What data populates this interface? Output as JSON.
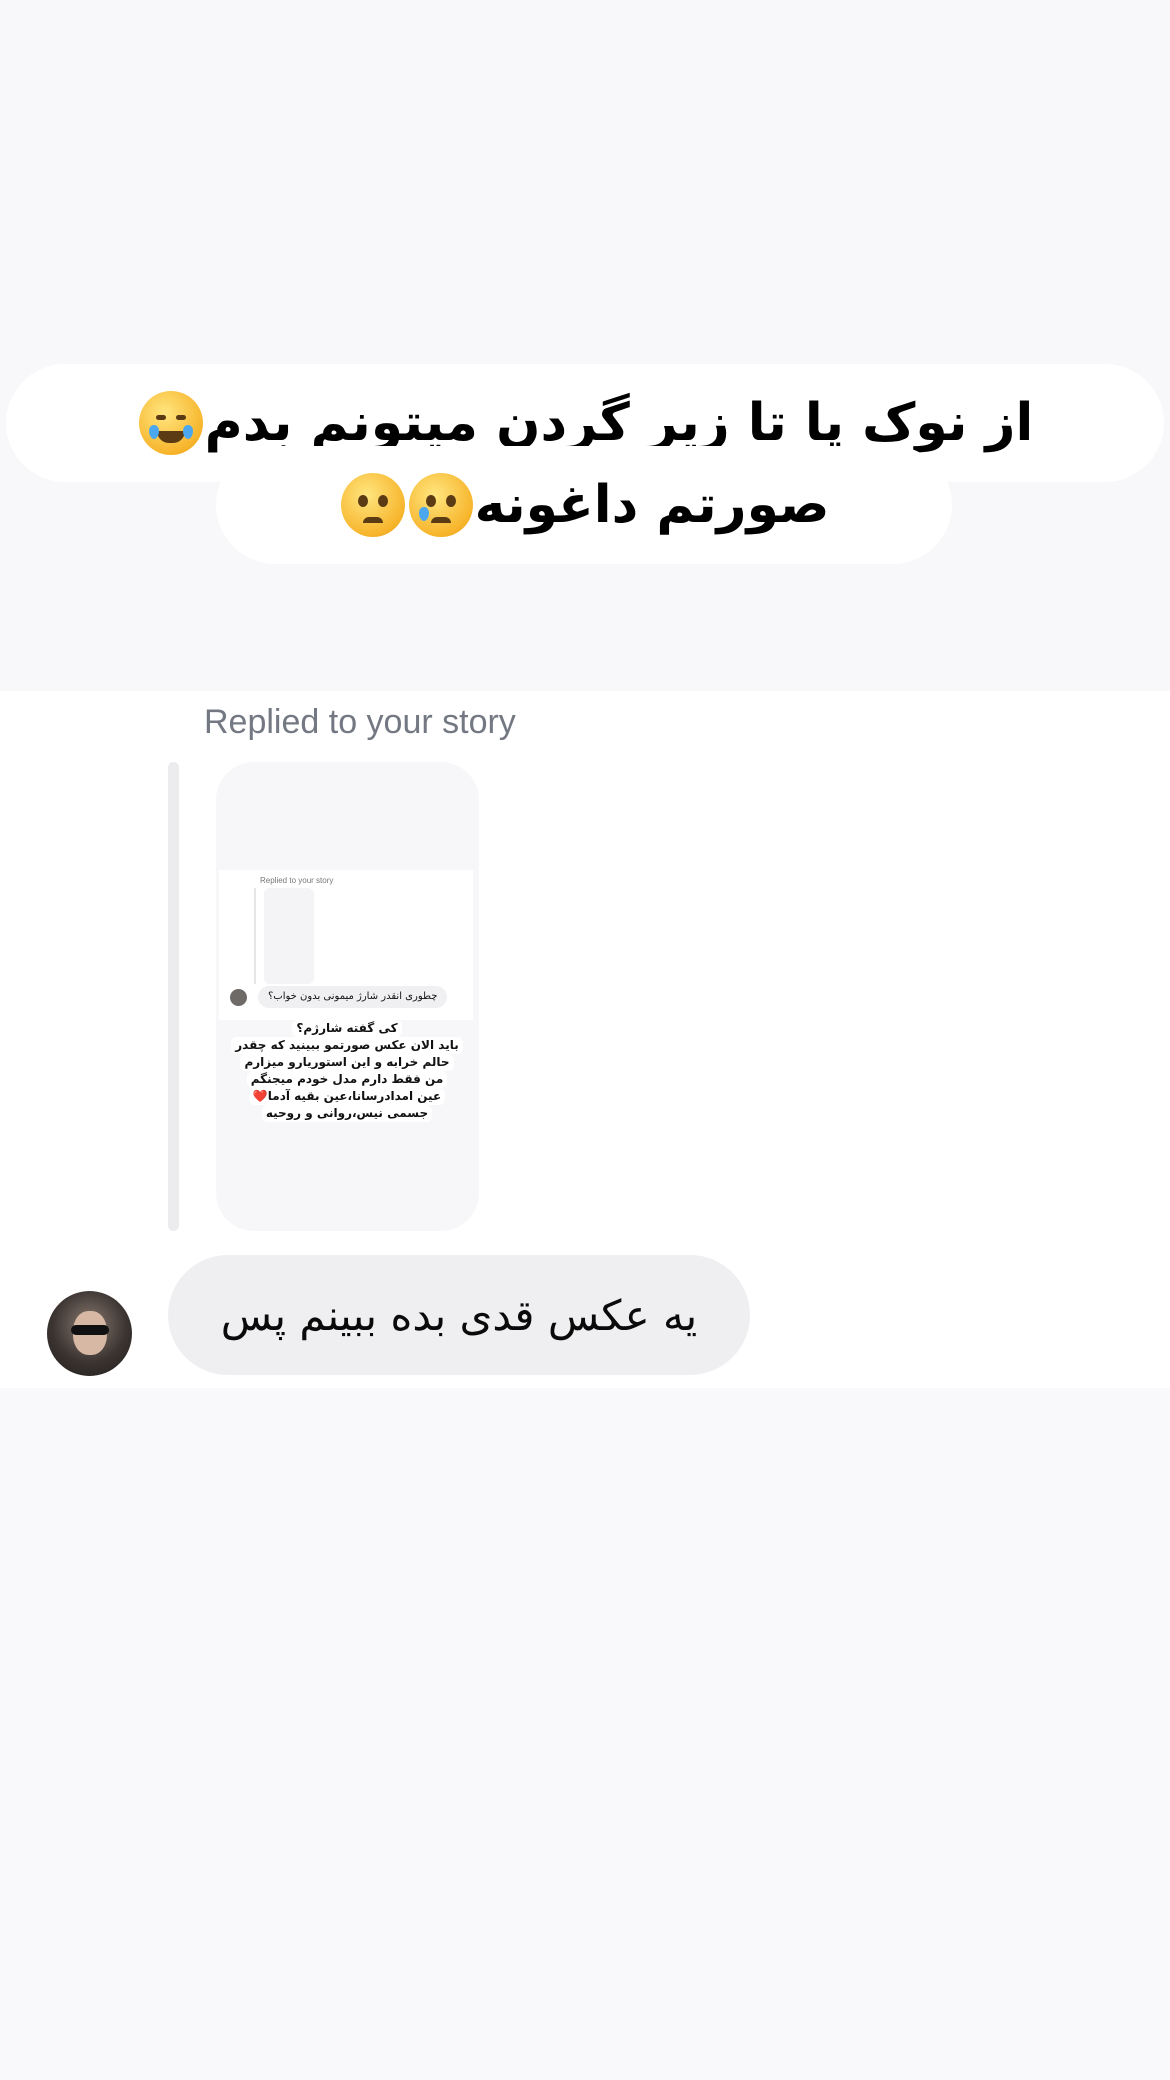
{
  "story": {
    "line1": "از نوک پا تا زیر گردن میتونم بدم",
    "line1_emoji": "face-with-tears-of-joy",
    "line2": "صورتم داغونه",
    "line2_emojis": [
      "crying-face",
      "pleading-face"
    ]
  },
  "reply": {
    "label": "Replied to your story",
    "thumbnail": {
      "inner_label": "Replied to your story",
      "chat_message": "چطوری انقدر شارژ میمونی بدون خواب؟",
      "caption_lines": [
        "کی گفته شارژم؟",
        "باید الان عکس صورتمو ببینید که چقدر",
        "حالم خرابه و این استوریارو میزارم",
        "من فقط دارم مدل خودم میجنگم",
        "عین امدادرسانا،عین بقیه آدما❤️",
        "جسمی نیس،روانی و روحیه"
      ]
    }
  },
  "message": {
    "text": "یه عکس قدی بده ببینم پس",
    "avatar": "user-avatar"
  }
}
